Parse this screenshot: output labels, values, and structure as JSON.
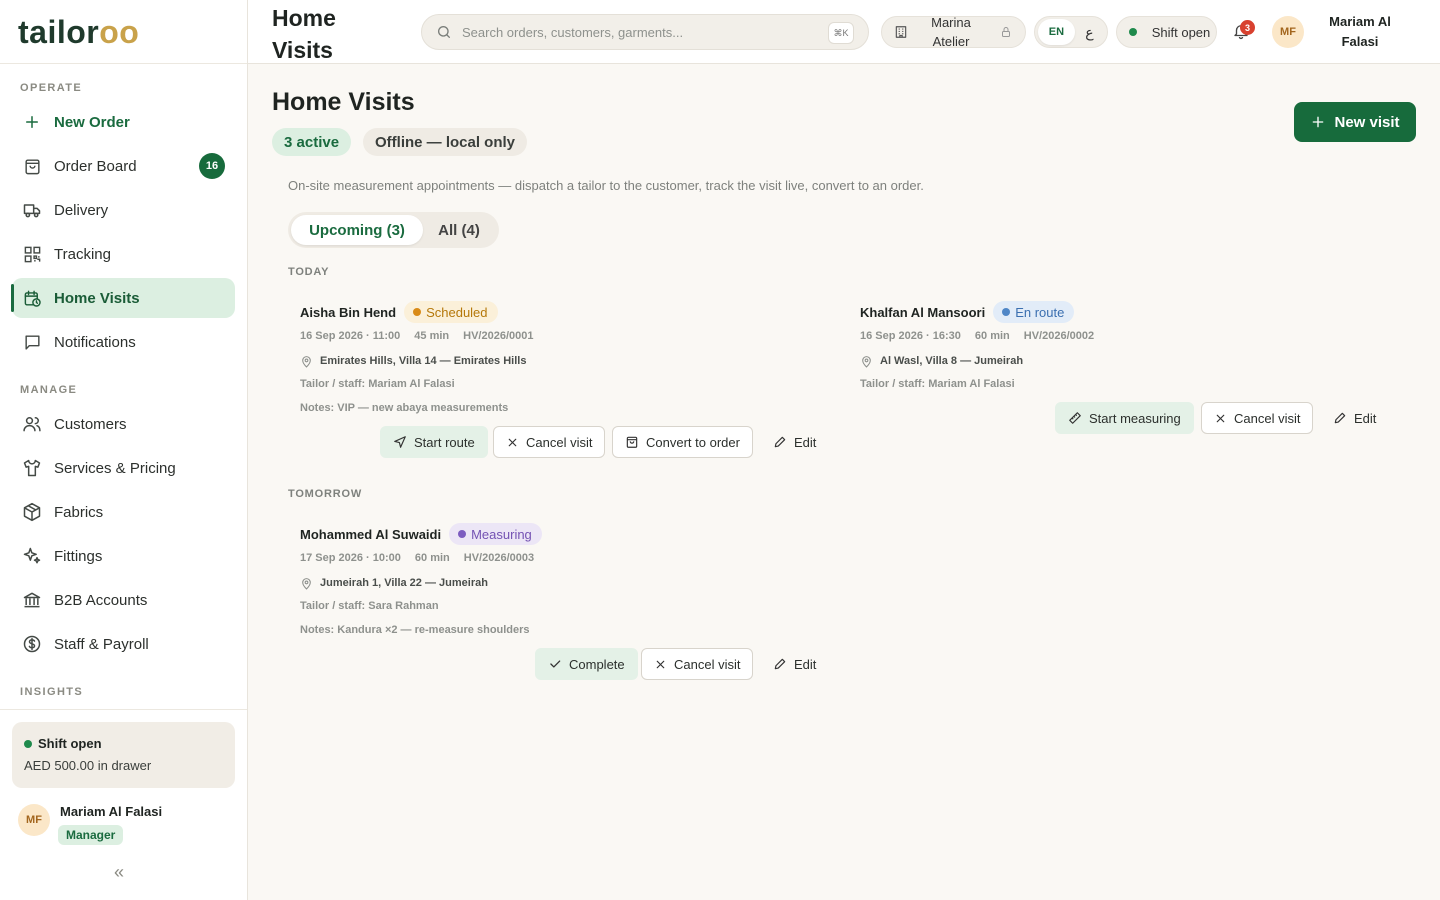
{
  "brand": {
    "part1": "tailor",
    "part2": "oo"
  },
  "sidebar": {
    "sections": {
      "operate": "OPERATE",
      "manage": "MANAGE",
      "insights": "INSIGHTS"
    },
    "items": [
      {
        "label": "New Order",
        "icon": "plus-icon"
      },
      {
        "label": "Order Board",
        "icon": "shopping-bag-icon",
        "badge": "16"
      },
      {
        "label": "Delivery",
        "icon": "truck-icon"
      },
      {
        "label": "Tracking",
        "icon": "qr-icon"
      },
      {
        "label": "Home Visits",
        "icon": "calendar-clock-icon"
      },
      {
        "label": "Notifications",
        "icon": "message-square-icon"
      },
      {
        "label": "Customers",
        "icon": "users-icon"
      },
      {
        "label": "Services & Pricing",
        "icon": "shirt-icon"
      },
      {
        "label": "Fabrics",
        "icon": "package-icon"
      },
      {
        "label": "Fittings",
        "icon": "sparkles-icon"
      },
      {
        "label": "B2B Accounts",
        "icon": "bank-icon"
      },
      {
        "label": "Staff & Payroll",
        "icon": "dollar-circle-icon"
      }
    ],
    "shift": {
      "status": "Shift open",
      "drawer": "AED 500.00 in drawer"
    },
    "user": {
      "initials": "MF",
      "name": "Mariam Al Falasi",
      "role": "Manager"
    },
    "collapse_glyph": "«"
  },
  "header": {
    "title": "Home Visits",
    "search_placeholder": "Search orders, customers, garments...",
    "kbd": "⌘K",
    "store": "Marina Atelier",
    "lang_en": "EN",
    "lang_ar": "ع",
    "shift": "Shift open",
    "notif_count": "3",
    "user_initials": "MF",
    "user_name": "Mariam Al Falasi"
  },
  "page": {
    "title": "Home Visits",
    "active_chip": "3 active",
    "offline_chip": "Offline — local only",
    "new_visit": "New visit",
    "subtitle": "On-site measurement appointments — dispatch a tailor to the customer, track the visit live, convert to an order.",
    "tabs": {
      "upcoming": "Upcoming (3)",
      "all": "All (4)"
    },
    "groups": {
      "today": "TODAY",
      "tomorrow": "TOMORROW"
    }
  },
  "visits": [
    {
      "customer": "Aisha Bin Hend",
      "status": "Scheduled",
      "datetime": "16 Sep 2026 · 11:00",
      "duration": "45 min",
      "ref": "HV/2026/0001",
      "address": "Emirates Hills, Villa 14 — Emirates Hills",
      "staff": "Tailor / staff: Mariam Al Falasi",
      "notes": "Notes: VIP — new abaya measurements",
      "actions": [
        "Start route",
        "Cancel visit",
        "Convert to order",
        "Edit"
      ]
    },
    {
      "customer": "Khalfan Al Mansoori",
      "status": "En route",
      "datetime": "16 Sep 2026 · 16:30",
      "duration": "60 min",
      "ref": "HV/2026/0002",
      "address": "Al Wasl, Villa 8 — Jumeirah",
      "staff": "Tailor / staff: Mariam Al Falasi",
      "actions": [
        "Start measuring",
        "Cancel visit",
        "Edit"
      ]
    },
    {
      "customer": "Mohammed Al Suwaidi",
      "status": "Measuring",
      "datetime": "17 Sep 2026 · 10:00",
      "duration": "60 min",
      "ref": "HV/2026/0003",
      "address": "Jumeirah 1, Villa 22 — Jumeirah",
      "staff": "Tailor / staff: Sara Rahman",
      "notes": "Notes: Kandura ×2 — re-measure shoulders",
      "actions": [
        "Complete",
        "Cancel visit",
        "Edit"
      ]
    }
  ],
  "colors": {
    "brand_green": "#176b3c",
    "brand_gold": "#c9a24a",
    "active_bg": "#dcefe1"
  }
}
